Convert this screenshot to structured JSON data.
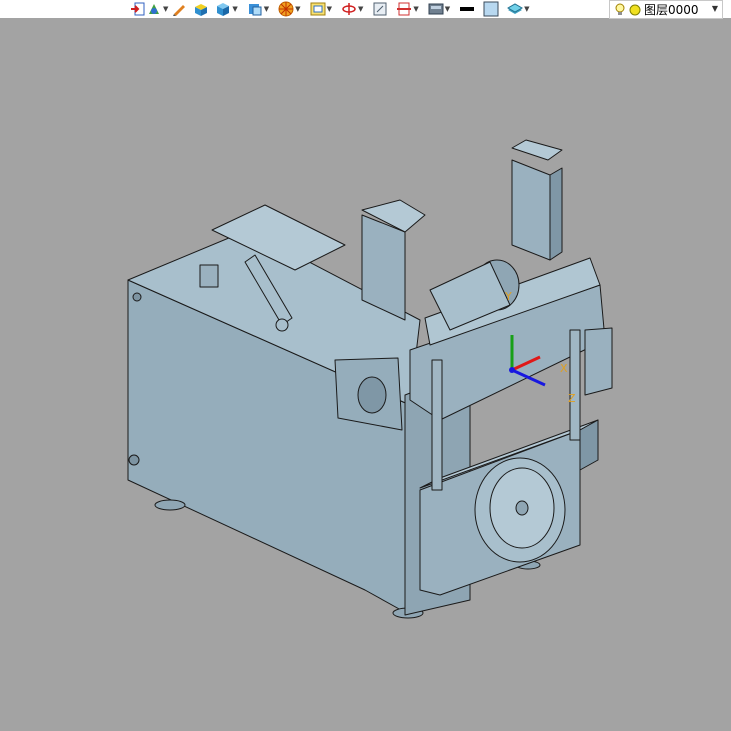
{
  "toolbar": {
    "icons": [
      "exit-sketch-icon",
      "datum-icon",
      "edit-pen-icon",
      "solid-block-icon",
      "shaded-cube-icon",
      "view-cube-icon",
      "wheel-filter-icon",
      "zoom-frame-icon",
      "rotate-view-icon",
      "fit-view-icon",
      "section-view-icon",
      "display-mode-icon",
      "line-color-swatch",
      "face-color-swatch",
      "layer-stack-icon"
    ],
    "dropdown_glyph": "▼",
    "layer": {
      "label": "图层0000",
      "dropdown_glyph": "▼"
    }
  },
  "viewport": {
    "background": "#a3a3a3",
    "model_face_color": "#9ab1bf",
    "model_shadow_color": "#7f97a6",
    "triad": {
      "x_label": "X",
      "y_label": "Y",
      "z_label": "Z",
      "x_color": "#e01818",
      "y_color": "#18a018",
      "z_color": "#1818e0"
    }
  }
}
